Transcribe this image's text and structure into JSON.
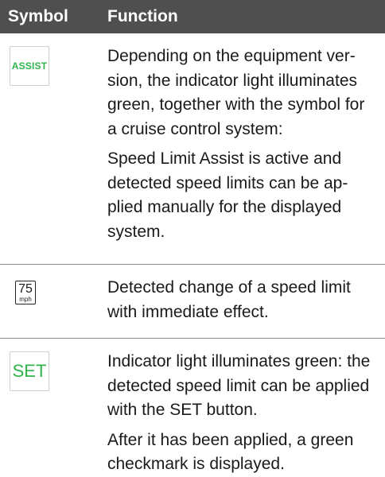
{
  "header": {
    "symbol": "Symbol",
    "function": "Function"
  },
  "rows": [
    {
      "icon_name": "assist-indicator-icon",
      "icon_text": "ASSIST",
      "paragraphs": [
        "Depending on the equipment ver-sion, the indicator light illuminates green, together with the symbol for a cruise control system:",
        "Speed Limit Assist is active and detected speed limits can be ap-plied manually for the displayed system."
      ]
    },
    {
      "icon_name": "speed-limit-75-mph-icon",
      "icon_number": "75",
      "icon_unit": "mph",
      "paragraphs": [
        "Detected change of a speed limit with immediate effect."
      ]
    },
    {
      "icon_name": "set-indicator-icon",
      "icon_text": "SET",
      "paragraphs": [
        "Indicator light illuminates green: the detected speed limit can be applied with the SET button.",
        "After it has been applied, a green checkmark is displayed."
      ]
    }
  ],
  "colors": {
    "header_bg": "#4f4f4f",
    "indicator_green": "#2fb34a"
  }
}
